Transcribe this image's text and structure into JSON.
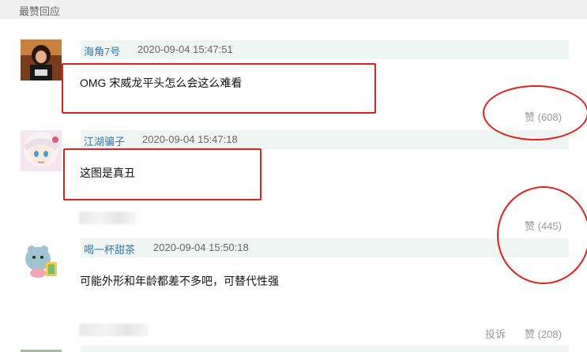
{
  "section_title": "最赞回应",
  "colors": {
    "username": "#3377aa",
    "annotation_red": "#e0201a",
    "meta_bar": "#eef5f3"
  },
  "comments": [
    {
      "username": "海角7号",
      "time": "2020-09-04 15:47:51",
      "content": "OMG 宋威龙平头怎么会这么难看",
      "likes": "赞 (608)",
      "avatar": "photo-avatar"
    },
    {
      "username": "江湖骗子",
      "time": "2020-09-04 15:47:18",
      "content": "这图是真丑",
      "likes": "赞 (445)",
      "avatar": "anime-girl-avatar"
    },
    {
      "username": "喝一杯甜茶",
      "time": "2020-09-04 15:50:18",
      "content": "可能外形和年龄都差不多吧，可替代性强",
      "likes": "赞 (208)",
      "report": "投诉",
      "avatar": "cartoon-animal-avatar"
    }
  ]
}
